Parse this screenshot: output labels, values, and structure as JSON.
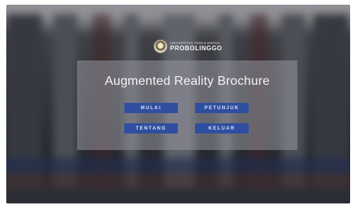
{
  "app": {
    "institution_small": "UNIVERSITAS PANCA MARGA",
    "institution_name": "PROBOLINGGO",
    "title": "Augmented Reality Brochure"
  },
  "menu": {
    "buttons": [
      {
        "label": "MULAI"
      },
      {
        "label": "PETUNJUK"
      },
      {
        "label": "TENTANG"
      },
      {
        "label": "KELUAR"
      }
    ]
  },
  "colors": {
    "button_bg": "#2f4ea0",
    "panel_bg": "#9696a0",
    "title_text": "#f4f4f6"
  }
}
